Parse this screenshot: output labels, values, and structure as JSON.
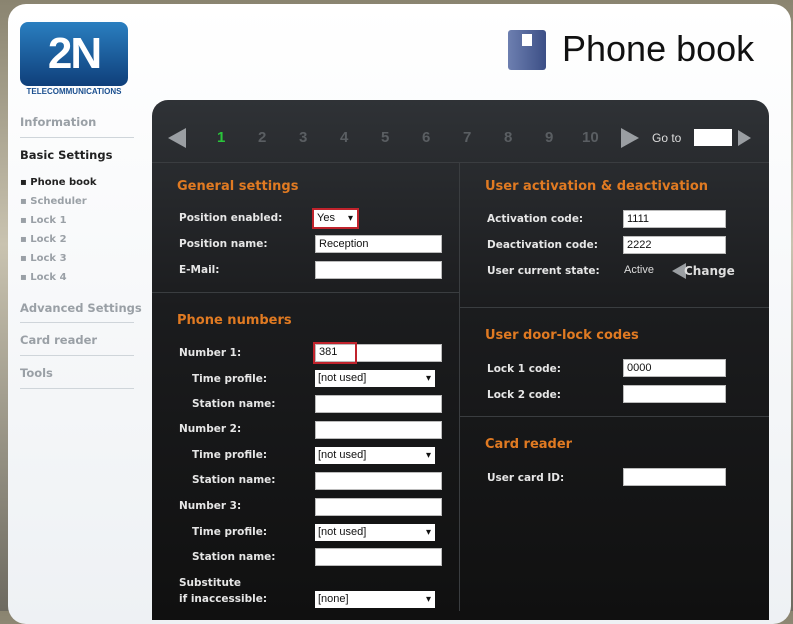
{
  "brand": {
    "logo": "2N",
    "logo_sub": "TELECOMMUNICATIONS"
  },
  "header": {
    "title": "Phone book",
    "icon": "phonebook-icon"
  },
  "sidebar": {
    "items": [
      {
        "label": "Information"
      },
      {
        "label": "Basic Settings"
      },
      {
        "label": "Advanced Settings"
      },
      {
        "label": "Card reader"
      },
      {
        "label": "Tools"
      }
    ],
    "sub_items": [
      {
        "label": "Phone book"
      },
      {
        "label": "Scheduler"
      },
      {
        "label": "Lock 1"
      },
      {
        "label": "Lock 2"
      },
      {
        "label": "Lock 3"
      },
      {
        "label": "Lock 4"
      }
    ]
  },
  "pagination": {
    "pages": [
      "1",
      "2",
      "3",
      "4",
      "5",
      "6",
      "7",
      "8",
      "9",
      "10"
    ],
    "current": "1",
    "goto_label": "Go to",
    "goto_value": ""
  },
  "general": {
    "title": "General settings",
    "position_enabled_label": "Position enabled:",
    "position_enabled": "Yes",
    "position_name_label": "Position name:",
    "position_name": "Reception",
    "email_label": "E-Mail:",
    "email": ""
  },
  "phone": {
    "title": "Phone numbers",
    "number1_label": "Number 1:",
    "number1": "381",
    "number2_label": "Number 2:",
    "number2": "",
    "number3_label": "Number 3:",
    "number3": "",
    "time_profile_label": "Time profile:",
    "station_name_label": "Station name:",
    "time_profile": "[not used]",
    "substitute_label1": "Substitute",
    "substitute_label2": "if inaccessible:",
    "substitute": "[none]"
  },
  "activation": {
    "title": "User activation & deactivation",
    "activation_label": "Activation code:",
    "activation": "1111",
    "deactivation_label": "Deactivation code:",
    "deactivation": "2222",
    "state_label": "User current state:",
    "state": "Active",
    "change_label": "Change"
  },
  "locks": {
    "title": "User door-lock codes",
    "lock1_label": "Lock 1 code:",
    "lock1": "0000",
    "lock2_label": "Lock 2 code:",
    "lock2": ""
  },
  "card": {
    "title": "Card reader",
    "card_label": "User card ID:",
    "card": ""
  },
  "colors": {
    "accent": "#e07a22",
    "active_page": "#29c53a",
    "highlight": "#c0232c"
  }
}
